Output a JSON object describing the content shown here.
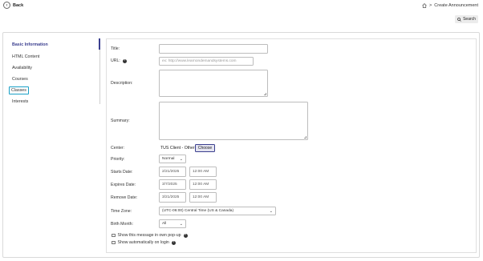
{
  "header": {
    "back_label": "Back",
    "breadcrumb_separator": ">",
    "breadcrumb_current": "Create Announcement",
    "search_label": "Search"
  },
  "sidebar": {
    "items": [
      {
        "label": "Basic Information",
        "state": "active"
      },
      {
        "label": "HTML Content",
        "state": "normal"
      },
      {
        "label": "Availability",
        "state": "normal"
      },
      {
        "label": "Courses",
        "state": "normal"
      },
      {
        "label": "Classes",
        "state": "focused"
      },
      {
        "label": "Interests",
        "state": "normal"
      }
    ]
  },
  "form": {
    "title_label": "Title:",
    "title_value": "",
    "url_label": "URL:",
    "url_placeholder": "ex: http://www.learnondemandsystems.com",
    "description_label": "Description:",
    "summary_label": "Summary:",
    "center_label": "Center:",
    "center_value": "TUS Client - Other",
    "choose_label": "Choose",
    "priority_label": "Priority:",
    "priority_value": "Normal",
    "starts_label": "Starts Date:",
    "starts_date": "2/21/2025",
    "starts_time": "12:00 AM",
    "expires_label": "Expires Date:",
    "expires_date": "3/7/2025",
    "expires_time": "12:00 AM",
    "remove_label": "Remove Date:",
    "remove_date": "3/21/2025",
    "remove_time": "12:00 AM",
    "timezone_label": "Time Zone:",
    "timezone_value": "(UTC-06:00) Central Time (US & Canada)",
    "birthmonth_label": "Birth Month:",
    "birthmonth_value": "All",
    "popup_label": "Show this message in own pop-up",
    "popup_checked": false,
    "login_label": "Show automatically on login",
    "login_checked": false
  },
  "colors": {
    "accent": "#3b3f8f",
    "focus": "#19a0c6"
  },
  "icons": [
    "chevron-left-icon",
    "home-icon",
    "search-icon",
    "help-icon",
    "chevron-down-icon"
  ]
}
